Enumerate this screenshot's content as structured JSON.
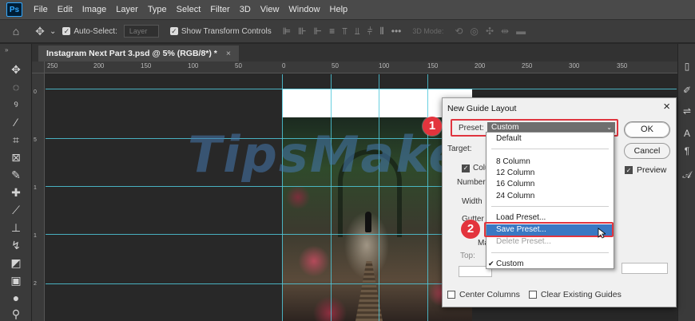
{
  "app": {
    "logo": "Ps"
  },
  "menu": [
    "File",
    "Edit",
    "Image",
    "Layer",
    "Type",
    "Select",
    "Filter",
    "3D",
    "View",
    "Window",
    "Help"
  ],
  "options_bar": {
    "auto_select_label": "Auto-Select:",
    "layer_field": "Layer",
    "transform_label": "Show Transform Controls",
    "mode_3d": "3D Mode:"
  },
  "document_tab": {
    "title": "Instagram Next Part 3.psd @ 5% (RGB/8*) *",
    "close": "×"
  },
  "rulers": {
    "top_labels": [
      "250",
      "200",
      "150",
      "100",
      "50",
      "0",
      "50",
      "100",
      "150",
      "200",
      "250",
      "300",
      "350"
    ],
    "left_labels": [
      "0",
      "5",
      "1",
      "1",
      "2"
    ]
  },
  "watermark": "TipsMake",
  "dialog": {
    "title": "New Guide Layout",
    "close": "×",
    "preset_label": "Preset:",
    "preset_value": "Custom",
    "target_label": "Target:",
    "columns_label": "Colu",
    "number_label": "Number",
    "width_label": "Width",
    "gutter_label": "Gutter",
    "margin_label": "Mar",
    "top_label": "Top:",
    "ok": "OK",
    "cancel": "Cancel",
    "preview": "Preview",
    "center_columns": "Center Columns",
    "clear_guides": "Clear Existing Guides"
  },
  "dropdown": {
    "items": [
      {
        "label": "Default",
        "state": "normal"
      },
      {
        "label": "8 Column",
        "state": "normal"
      },
      {
        "label": "12 Column",
        "state": "normal"
      },
      {
        "label": "16 Column",
        "state": "normal"
      },
      {
        "label": "24 Column",
        "state": "normal"
      },
      {
        "label": "Load Preset...",
        "state": "normal"
      },
      {
        "label": "Save Preset...",
        "state": "selected"
      },
      {
        "label": "Delete Preset...",
        "state": "disabled"
      },
      {
        "label": "Custom",
        "state": "checked"
      }
    ]
  },
  "steps": {
    "step1": "1",
    "step2": "2"
  },
  "colors": {
    "highlight": "#e0353f",
    "badge": "#e3343d",
    "selected": "#3a78c3",
    "guide": "#4fc8da"
  }
}
